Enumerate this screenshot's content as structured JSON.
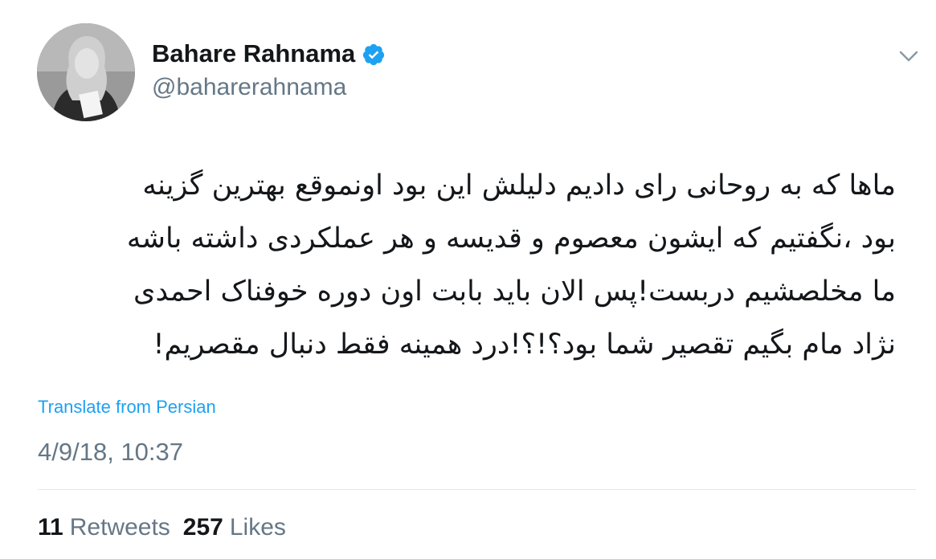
{
  "author": {
    "display_name": "Bahare Rahnama",
    "handle": "@baharerahnama",
    "verified": true,
    "avatar_icon": "profile-photo"
  },
  "menu": {
    "icon": "chevron-down-icon"
  },
  "tweet": {
    "lines": [
      "ماها که به روحانی رای دادیم دلیلش این بود  اونموقع بهترین گزینه",
      "بود ،نگفتیم که ایشون معصوم و قدیسه و هر عملکردی داشته باشه",
      "ما مخلصشیم دربست!پس الان باید بابت اون دوره خوفناک احمدی",
      "نژاد مام بگیم تقصیر شما بود؟!؟!درد همینه فقط دنبال مقصریم!"
    ],
    "translate_label": "Translate from Persian",
    "timestamp": "4/9/18, 10:37"
  },
  "stats": {
    "retweets_count": "11",
    "retweets_label": "Retweets",
    "likes_count": "257",
    "likes_label": "Likes"
  },
  "colors": {
    "accent": "#1da1f2",
    "muted": "#657786",
    "divider": "#e1e8ed"
  }
}
